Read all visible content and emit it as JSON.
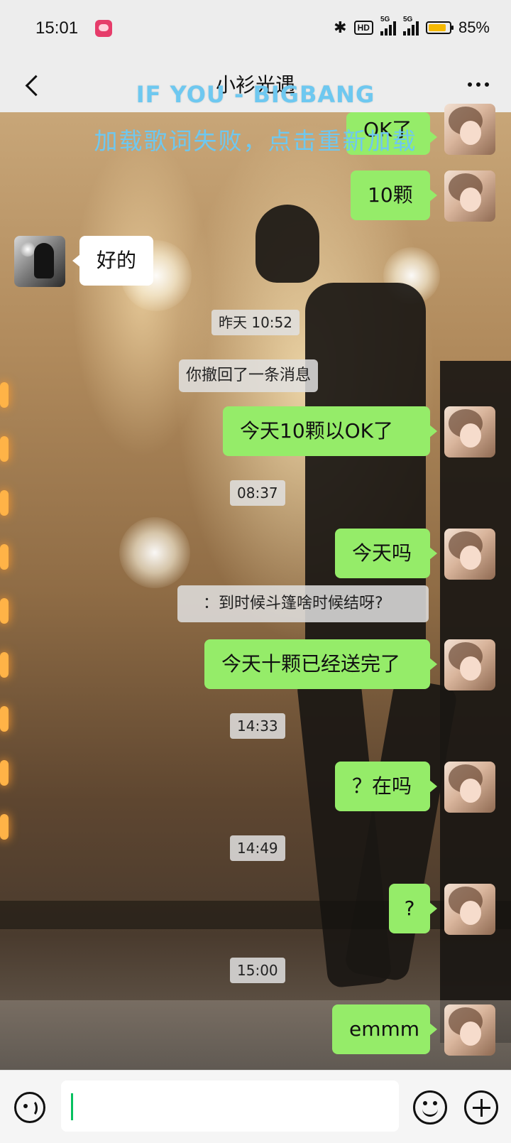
{
  "status_bar": {
    "time": "15:01",
    "hd_label": "HD",
    "signal1_label": "5G",
    "signal2_label": "5G",
    "battery_text": "85%",
    "battery_level": 0.85,
    "battery_color": "#f5b800"
  },
  "header": {
    "title": "小衫光遇"
  },
  "lyrics": {
    "song": "IF YOU - BIGBANG",
    "status": "加载歌词失败，点击重新加载",
    "color": "#6ec8f0"
  },
  "messages": [
    {
      "type": "out",
      "text": "OK了"
    },
    {
      "type": "out",
      "text": "10颗"
    },
    {
      "type": "in",
      "text": "好的"
    },
    {
      "type": "time",
      "text": "昨天 10:52"
    },
    {
      "type": "system",
      "text": "你撤回了一条消息"
    },
    {
      "type": "out",
      "text": "今天10颗以OK了"
    },
    {
      "type": "time",
      "text": "08:37"
    },
    {
      "type": "out",
      "text": "今天吗"
    },
    {
      "type": "system",
      "text": "：到时候斗篷啥时候结呀?"
    },
    {
      "type": "out",
      "text": "今天十颗已经送完了"
    },
    {
      "type": "time",
      "text": "14:33"
    },
    {
      "type": "out",
      "text": "？在吗"
    },
    {
      "type": "time",
      "text": "14:49"
    },
    {
      "type": "out",
      "text": "?"
    },
    {
      "type": "time",
      "text": "15:00"
    },
    {
      "type": "out",
      "text": "emmm"
    }
  ],
  "colors": {
    "outgoing_bubble": "#95ec69",
    "incoming_bubble": "#ffffff",
    "caret": "#07c160"
  },
  "input": {
    "value": "",
    "placeholder": ""
  }
}
